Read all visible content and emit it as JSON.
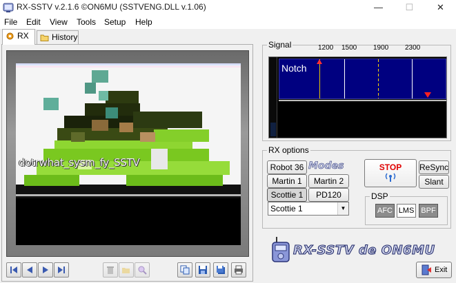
{
  "window": {
    "title": "RX-SSTV v.2.1.6 ©ON6MU (SSTVENG.DLL v.1.06)",
    "minimize": "—",
    "maximize": "☐",
    "close": "✕"
  },
  "menu": [
    "File",
    "Edit",
    "View",
    "Tools",
    "Setup",
    "Help"
  ],
  "tabs": [
    {
      "label": "RX",
      "active": true
    },
    {
      "label": "History",
      "active": false
    }
  ],
  "image": {
    "overlay_text": "dotrwhat_sysm_fy_SSTV"
  },
  "signal": {
    "label": "Signal",
    "scale": [
      "1200",
      "1500",
      "1900",
      "2300"
    ],
    "notch_label": "Notch"
  },
  "rx_options": {
    "label": "RX options",
    "modes_logo": "Modes",
    "mode_buttons": [
      "Robot 36",
      "Martin 1",
      "Martin 2",
      "Scottie 1",
      "PD120"
    ],
    "active_mode": "Scottie 1",
    "selected_mode": "Scottie 1",
    "stop_label": "STOP",
    "resync_label": "ReSync",
    "slant_label": "Slant"
  },
  "dsp": {
    "label": "DSP",
    "buttons": [
      {
        "label": "AFC",
        "on": true
      },
      {
        "label": "LMS",
        "on": false
      },
      {
        "label": "BPF",
        "on": true
      }
    ]
  },
  "brand": {
    "text": "RX-SSTV de ON6MU"
  },
  "exit_label": "Exit",
  "colors": {
    "spectrum_bg": "#000080",
    "stop_red": "#e00000",
    "dsp_on": "#8c8c8c"
  }
}
